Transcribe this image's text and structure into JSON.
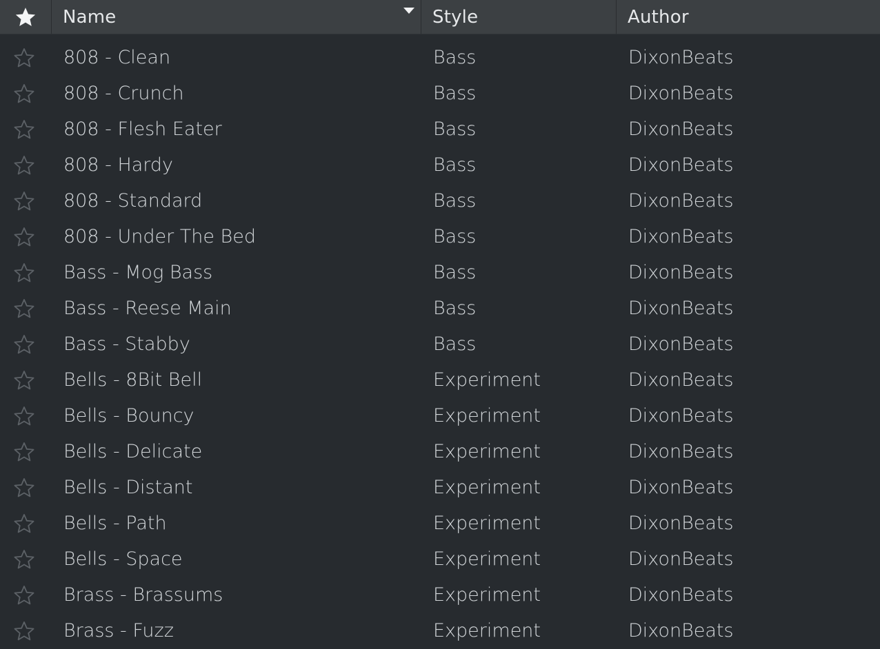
{
  "columns": {
    "favorite_icon": "star-filled-icon",
    "name": "Name",
    "style": "Style",
    "author": "Author",
    "sort_indicator": "sort-descending-arrow"
  },
  "colors": {
    "background": "#272b2f",
    "header_background": "#3c4043",
    "text": "#d2d6d9",
    "header_text": "#e6e8ea",
    "star_outline": "#5c6166"
  },
  "presets": [
    {
      "name": "808 - Clean",
      "style": "Bass",
      "author": "DixonBeats",
      "favorite": false
    },
    {
      "name": "808 - Crunch",
      "style": "Bass",
      "author": "DixonBeats",
      "favorite": false
    },
    {
      "name": "808 - Flesh Eater",
      "style": "Bass",
      "author": "DixonBeats",
      "favorite": false
    },
    {
      "name": "808 - Hardy",
      "style": "Bass",
      "author": "DixonBeats",
      "favorite": false
    },
    {
      "name": "808 - Standard",
      "style": "Bass",
      "author": "DixonBeats",
      "favorite": false
    },
    {
      "name": "808 - Under The Bed",
      "style": "Bass",
      "author": "DixonBeats",
      "favorite": false
    },
    {
      "name": "Bass - Mog Bass",
      "style": "Bass",
      "author": "DixonBeats",
      "favorite": false
    },
    {
      "name": "Bass - Reese Main",
      "style": "Bass",
      "author": "DixonBeats",
      "favorite": false
    },
    {
      "name": "Bass - Stabby",
      "style": "Bass",
      "author": "DixonBeats",
      "favorite": false
    },
    {
      "name": "Bells - 8Bit Bell",
      "style": "Experiment",
      "author": "DixonBeats",
      "favorite": false
    },
    {
      "name": "Bells - Bouncy",
      "style": "Experiment",
      "author": "DixonBeats",
      "favorite": false
    },
    {
      "name": "Bells - Delicate",
      "style": "Experiment",
      "author": "DixonBeats",
      "favorite": false
    },
    {
      "name": "Bells - Distant",
      "style": "Experiment",
      "author": "DixonBeats",
      "favorite": false
    },
    {
      "name": "Bells - Path",
      "style": "Experiment",
      "author": "DixonBeats",
      "favorite": false
    },
    {
      "name": "Bells - Space",
      "style": "Experiment",
      "author": "DixonBeats",
      "favorite": false
    },
    {
      "name": "Brass - Brassums",
      "style": "Experiment",
      "author": "DixonBeats",
      "favorite": false
    },
    {
      "name": "Brass - Fuzz",
      "style": "Experiment",
      "author": "DixonBeats",
      "favorite": false
    }
  ]
}
